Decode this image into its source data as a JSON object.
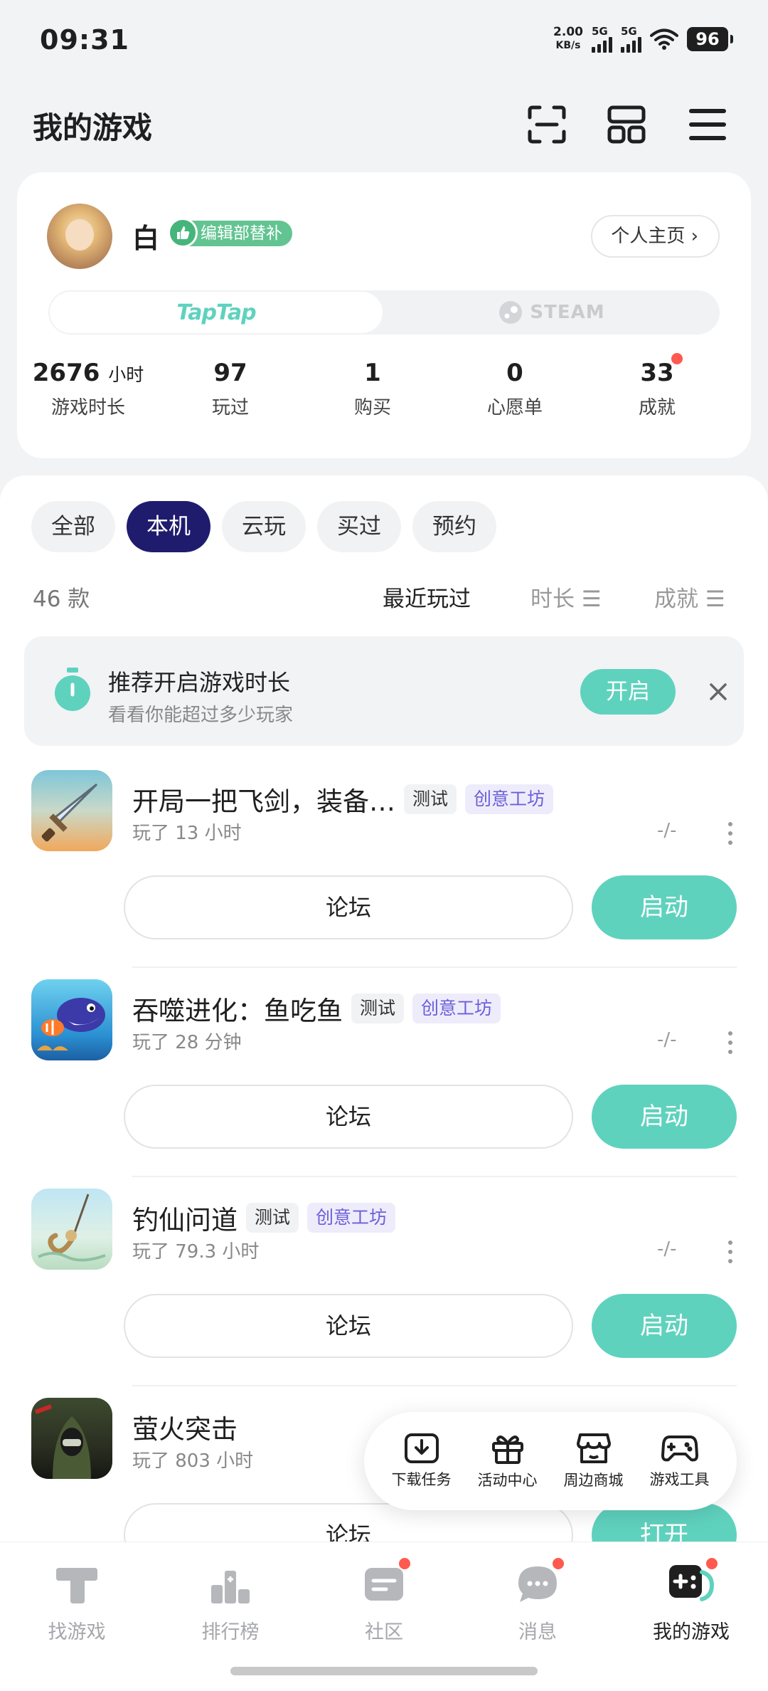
{
  "status": {
    "time": "09:31",
    "speed_value": "2.00",
    "speed_unit": "KB/s",
    "sim1": "5G",
    "sim2": "5G",
    "battery": "96"
  },
  "header": {
    "title": "我的游戏"
  },
  "profile": {
    "name": "白",
    "badge": "编辑部替补",
    "homepage": "个人主页 ›",
    "tabs": {
      "taptap": "TapTap",
      "steam": "STEAM"
    },
    "stats": [
      {
        "value": "2676",
        "unit": "小时",
        "label": "游戏时长"
      },
      {
        "value": "97",
        "unit": "",
        "label": "玩过"
      },
      {
        "value": "1",
        "unit": "",
        "label": "购买"
      },
      {
        "value": "0",
        "unit": "",
        "label": "心愿单"
      },
      {
        "value": "33",
        "unit": "",
        "label": "成就"
      }
    ]
  },
  "filters": [
    "全部",
    "本机",
    "云玩",
    "买过",
    "预约"
  ],
  "active_filter": "本机",
  "count": "46 款",
  "sort": {
    "recent": "最近玩过",
    "duration": "时长 ☰",
    "achievement": "成就 ☰"
  },
  "promo": {
    "title": "推荐开启游戏时长",
    "subtitle": "看看你能超过多少玩家",
    "button": "开启"
  },
  "games": [
    {
      "name": "开局一把飞剑，装备…",
      "tags": [
        "测试",
        "创意工坊"
      ],
      "played": "玩了 13 小时",
      "rating": "-/-",
      "forum": "论坛",
      "action": "启动"
    },
    {
      "name": "吞噬进化：鱼吃鱼",
      "tags": [
        "测试",
        "创意工坊"
      ],
      "played": "玩了 28 分钟",
      "rating": "-/-",
      "forum": "论坛",
      "action": "启动"
    },
    {
      "name": "钓仙问道",
      "tags": [
        "测试",
        "创意工坊"
      ],
      "played": "玩了 79.3 小时",
      "rating": "-/-",
      "forum": "论坛",
      "action": "启动"
    },
    {
      "name": "萤火突击",
      "tags": [],
      "played": "玩了 803 小时",
      "rating": "",
      "forum": "论坛",
      "action": "打开"
    }
  ],
  "toolbar": [
    "下载任务",
    "活动中心",
    "周边商城",
    "游戏工具"
  ],
  "nav": [
    "找游戏",
    "排行榜",
    "社区",
    "消息",
    "我的游戏"
  ],
  "colors": {
    "accent": "#5fd2be",
    "active_chip": "#1f1c6e",
    "badge_green": "#62c491",
    "tag_purple": "#6a5fd8",
    "notify_red": "#ff5a4f"
  }
}
